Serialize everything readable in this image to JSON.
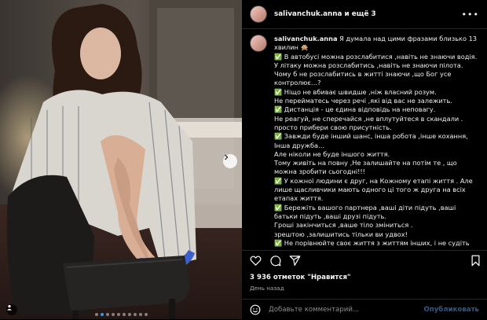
{
  "header": {
    "username_label": "salivanchuk.anna и ещё 3",
    "more_icon": "more-horizontal-icon"
  },
  "caption": {
    "username": "salivanchuk.anna",
    "lines": [
      "Я думала над цими фразами близько 13 хвилин 🙊",
      "✅ В автобусі можна розслабитися ,навіть не знаючи водія.",
      "У літаку можна розслабитись ,навіть не знаючи пілота.",
      "Чому б не розслабитись в житті знаючи ,що Бог усе контролює…?",
      "✅ Ніщо не вбиває швидше ,ніж власний розум.",
      "Не перейматесь через речі ,які від вас не залежить.",
      "✅ Дистанція - це єдина відповідь на неповагу.",
      "Не реагуй, не сперечайся ,не вплутуйтеся в скандали . просто прибери свою присутність.",
      "✅ Завжди буде інший шанс, інша робота ,інше кохання, Інша дружба…",
      "Але ніколи не буде іншого життя.",
      "Тому живіть на повну ,Не залишайте на потім те , що можна зробити сьогодні!!!",
      "✅ У кожної людини є друг, на Кожному етапі життя . Але лише щасливчики мають одного ці того ж друга на всіх етапах життя.",
      "✅ Бережіть вашого партнера ,ваші діти підуть ,ваші батьки підуть ,ваші друзі підуть.",
      "Гроші закінчиться ,ваше тіло зміниться .",
      "зрештою ,залишитись тільки ви удвох!",
      "✅ Не порівнюйте своє життя з життям інших, і не судіть"
    ]
  },
  "actions": {
    "like_icon": "heart-icon",
    "comment_icon": "comment-icon",
    "share_icon": "share-icon",
    "save_icon": "bookmark-icon"
  },
  "likes_text": "3 936 отметок \"Нравится\"",
  "timestamp": "День назад",
  "comment": {
    "placeholder": "Добавьте комментарий...",
    "publish_label": "Опубликовать"
  },
  "carousel": {
    "total_slides": 10,
    "active_slide": 2
  },
  "colors": {
    "background": "#000000",
    "check_green": "#43a047",
    "link_blue": "#2c5b87",
    "active_dot": "#3897f0"
  }
}
